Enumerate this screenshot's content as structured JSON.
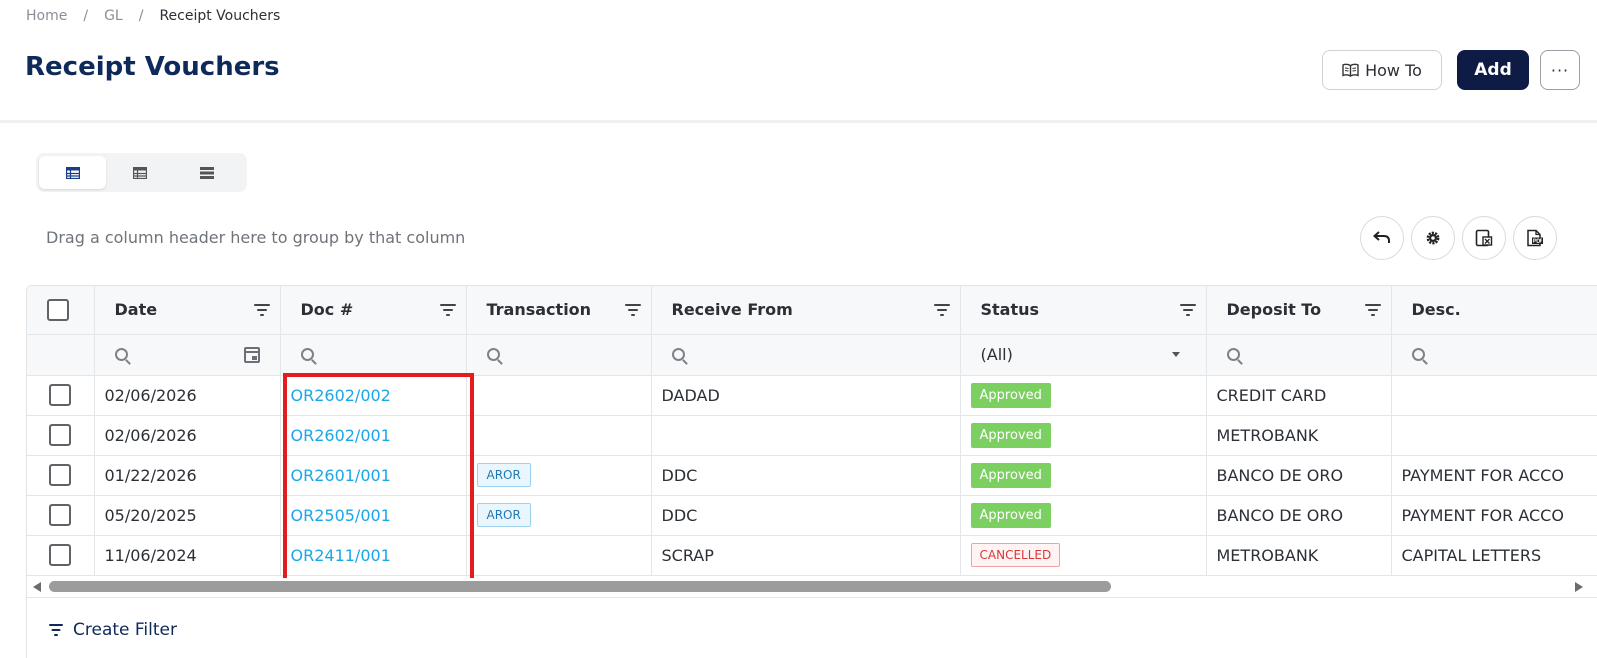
{
  "breadcrumb": {
    "home": "Home",
    "gl": "GL",
    "current": "Receipt Vouchers",
    "separator": "/"
  },
  "page": {
    "title": "Receipt Vouchers"
  },
  "actions": {
    "howto_label": "How To",
    "add_label": "Add",
    "more_label": "···"
  },
  "grid": {
    "group_hint": "Drag a column header here to group by that column",
    "columns": {
      "date": "Date",
      "doc": "Doc #",
      "transaction": "Transaction",
      "receive_from": "Receive From",
      "status": "Status",
      "deposit_to": "Deposit To",
      "desc": "Desc."
    },
    "status_filter_value": "(All)",
    "rows": [
      {
        "date": "02/06/2026",
        "doc": "OR2602/002",
        "transaction": "",
        "receive_from": "DADAD",
        "status": "Approved",
        "deposit_to": "CREDIT CARD",
        "desc": ""
      },
      {
        "date": "02/06/2026",
        "doc": "OR2602/001",
        "transaction": "",
        "receive_from": "",
        "status": "Approved",
        "deposit_to": "METROBANK",
        "desc": ""
      },
      {
        "date": "01/22/2026",
        "doc": "OR2601/001",
        "transaction": "AROR",
        "receive_from": "DDC",
        "status": "Approved",
        "deposit_to": "BANCO DE ORO",
        "desc": "PAYMENT FOR ACCO"
      },
      {
        "date": "05/20/2025",
        "doc": "OR2505/001",
        "transaction": "AROR",
        "receive_from": "DDC",
        "status": "Approved",
        "deposit_to": "BANCO DE ORO",
        "desc": "PAYMENT FOR ACCO"
      },
      {
        "date": "11/06/2024",
        "doc": "OR2411/001",
        "transaction": "",
        "receive_from": "SCRAP",
        "status": "CANCELLED",
        "deposit_to": "METROBANK",
        "desc": "CAPITAL LETTERS"
      }
    ],
    "create_filter_label": "Create Filter"
  },
  "icons": {
    "howto": "book-icon",
    "view_modes": [
      "table-view-icon",
      "list-view-icon",
      "compact-view-icon"
    ],
    "tools": [
      "undo-icon",
      "settings-icon",
      "export-excel-icon",
      "export-pdf-icon"
    ]
  },
  "colors": {
    "title": "#0e2a5a",
    "add_button": "#0d1b45",
    "link": "#1aa7e6",
    "approved": "#7ccf61",
    "cancelled": "#d8383a",
    "highlight": "#e31d1d"
  }
}
